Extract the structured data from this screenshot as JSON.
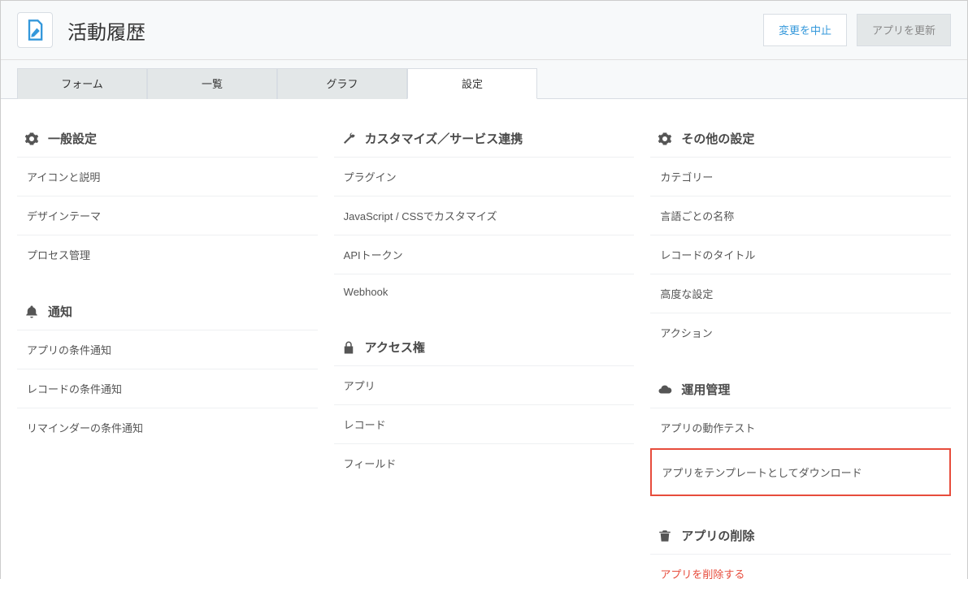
{
  "header": {
    "app_title": "活動履歴",
    "cancel_btn": "変更を中止",
    "update_btn": "アプリを更新"
  },
  "tabs": {
    "form": "フォーム",
    "list": "一覧",
    "graph": "グラフ",
    "settings": "設定"
  },
  "col1": {
    "general_head": "一般設定",
    "icon_desc": "アイコンと説明",
    "design_theme": "デザインテーマ",
    "process_mgmt": "プロセス管理",
    "notify_head": "通知",
    "app_notify": "アプリの条件通知",
    "record_notify": "レコードの条件通知",
    "reminder_notify": "リマインダーの条件通知"
  },
  "col2": {
    "customize_head": "カスタマイズ／サービス連携",
    "plugin": "プラグイン",
    "js_css": "JavaScript / CSSでカスタマイズ",
    "api_token": "APIトークン",
    "webhook": "Webhook",
    "access_head": "アクセス権",
    "app": "アプリ",
    "record": "レコード",
    "field": "フィールド"
  },
  "col3": {
    "other_head": "その他の設定",
    "category": "カテゴリー",
    "lang_name": "言語ごとの名称",
    "record_title": "レコードのタイトル",
    "advanced": "高度な設定",
    "action": "アクション",
    "ops_head": "運用管理",
    "app_test": "アプリの動作テスト",
    "template_dl": "アプリをテンプレートとしてダウンロード",
    "delete_head": "アプリの削除",
    "delete_app": "アプリを削除する"
  }
}
